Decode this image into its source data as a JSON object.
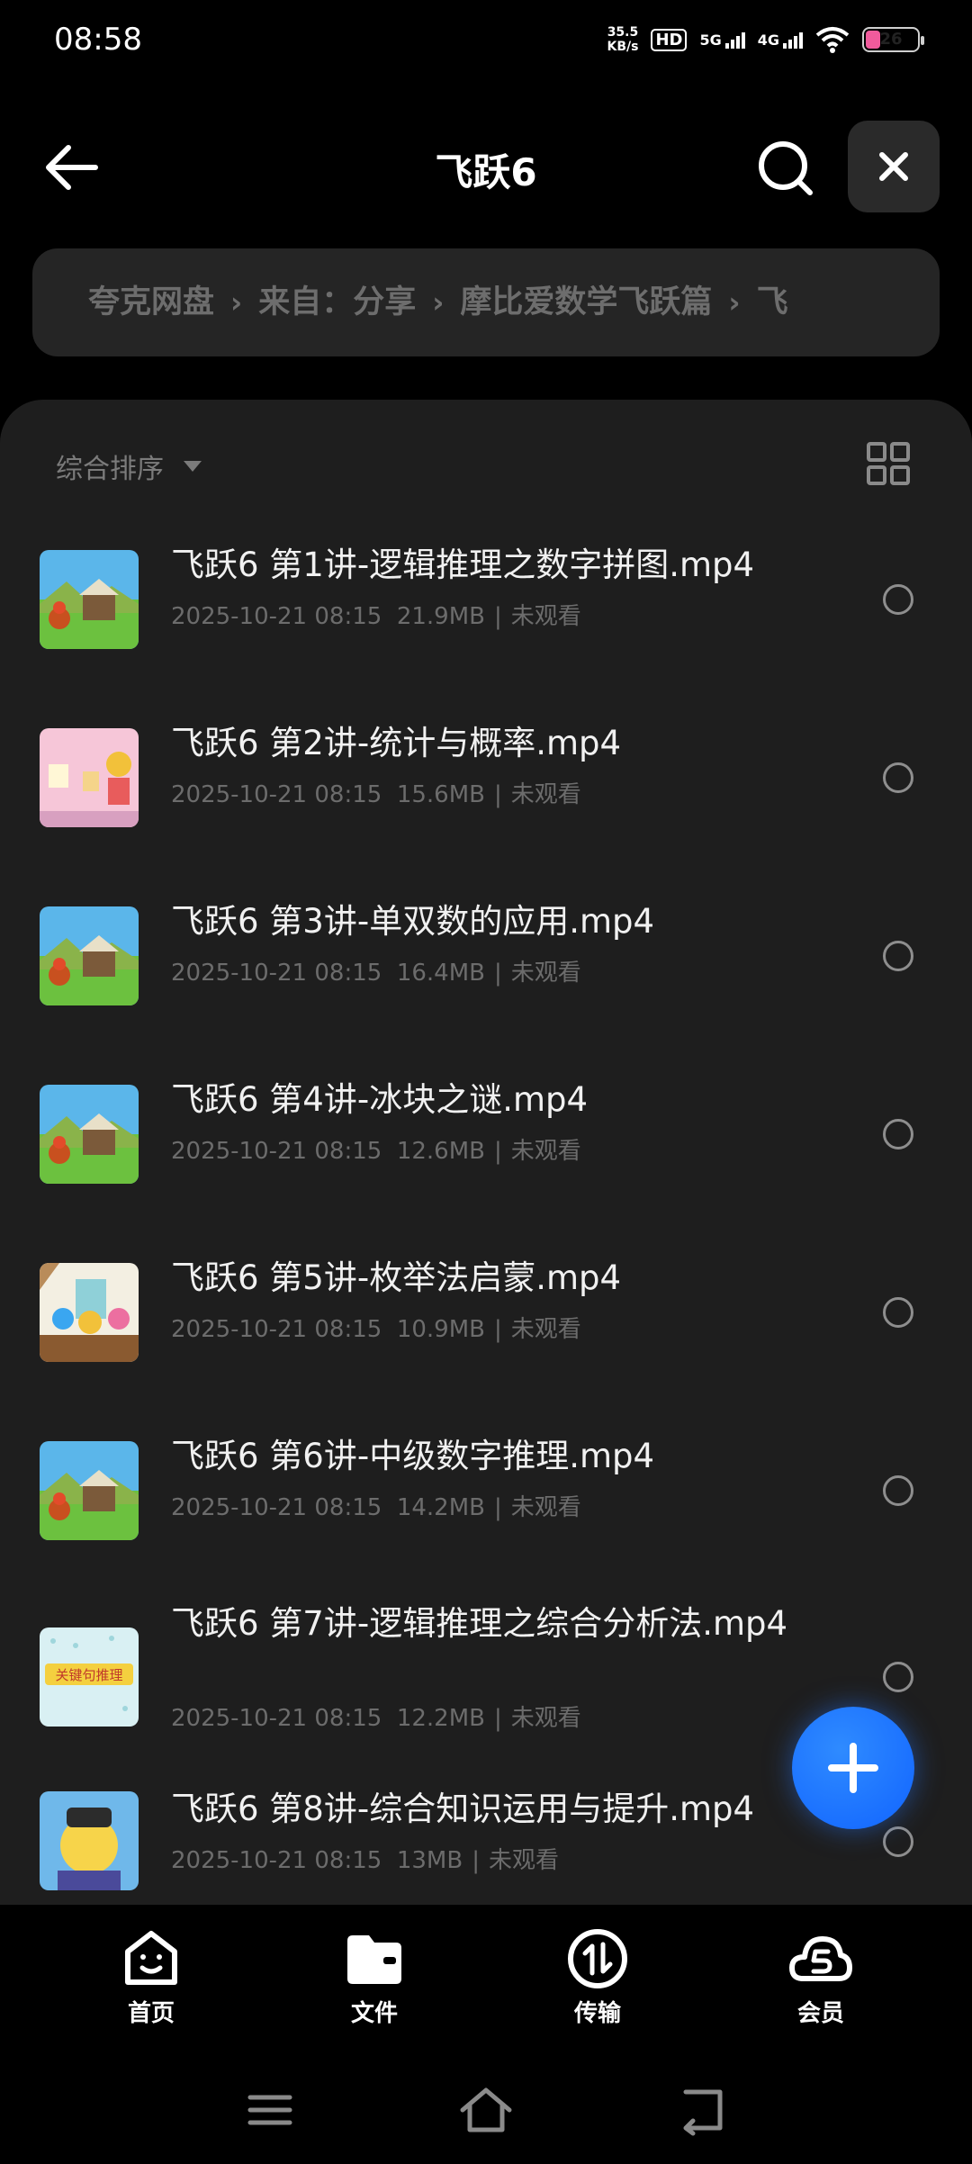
{
  "status_bar": {
    "time": "08:58",
    "net_speed_value": "35.5",
    "net_speed_unit": "KB/s",
    "hd_label": "HD",
    "sim1_label": "5G",
    "sim2_label": "4G",
    "battery": "26"
  },
  "header": {
    "title": "飞跃6"
  },
  "breadcrumb": {
    "items": [
      "夸克网盘",
      "来自：分享",
      "摩比爱数学飞跃篇",
      "飞"
    ]
  },
  "toolbar": {
    "sort_label": "综合排序"
  },
  "files": [
    {
      "name": "飞跃6 第1讲-逻辑推理之数字拼图.mp4",
      "date": "2025-10-21 08:15",
      "size": "21.9MB",
      "status": "未观看"
    },
    {
      "name": "飞跃6 第2讲-统计与概率.mp4",
      "date": "2025-10-21 08:15",
      "size": "15.6MB",
      "status": "未观看"
    },
    {
      "name": "飞跃6 第3讲-单双数的应用.mp4",
      "date": "2025-10-21 08:15",
      "size": "16.4MB",
      "status": "未观看"
    },
    {
      "name": "飞跃6 第4讲-冰块之谜.mp4",
      "date": "2025-10-21 08:15",
      "size": "12.6MB",
      "status": "未观看"
    },
    {
      "name": "飞跃6 第5讲-枚举法启蒙.mp4",
      "date": "2025-10-21 08:15",
      "size": "10.9MB",
      "status": "未观看"
    },
    {
      "name": "飞跃6 第6讲-中级数字推理.mp4",
      "date": "2025-10-21 08:15",
      "size": "14.2MB",
      "status": "未观看"
    },
    {
      "name": "飞跃6 第7讲-逻辑推理之综合分析法.mp4",
      "date": "2025-10-21 08:15",
      "size": "12.2MB",
      "status": "未观看",
      "thumb_text": "关键句推理"
    },
    {
      "name": "飞跃6 第8讲-综合知识运用与提升.mp4",
      "date": "2025-10-21 08:15",
      "size": "13MB",
      "status": "未观看"
    }
  ],
  "bottom_nav": {
    "items": [
      {
        "label": "首页",
        "icon": "smiley-box-icon"
      },
      {
        "label": "文件",
        "icon": "folder-icon"
      },
      {
        "label": "传输",
        "icon": "transfer-icon"
      },
      {
        "label": "会员",
        "icon": "cloud-vip-icon"
      }
    ]
  },
  "colors": {
    "background": "#000000",
    "panel": "#1e1e1e",
    "fab": "#1a6dff",
    "meta_text": "#6c6c6c"
  }
}
